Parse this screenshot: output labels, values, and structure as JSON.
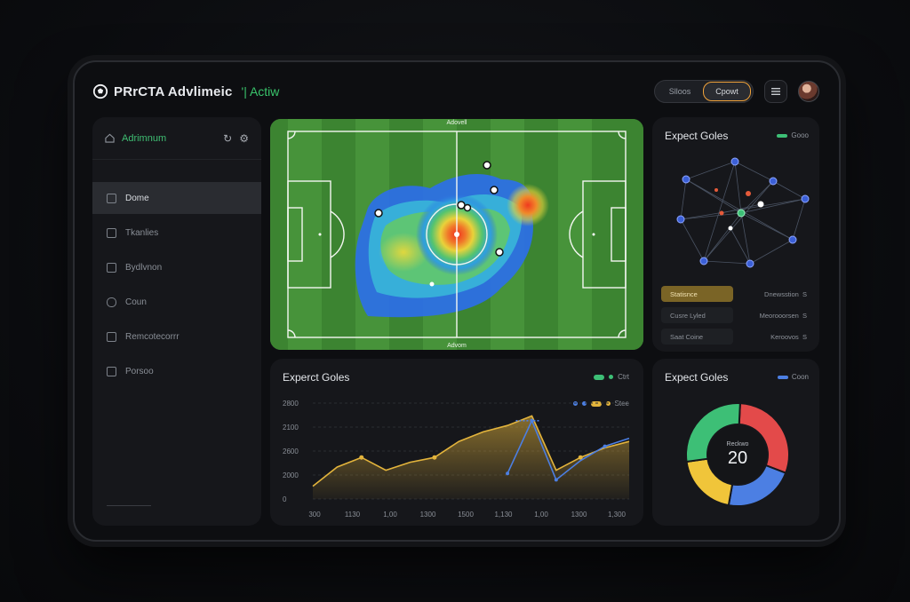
{
  "app": {
    "title": "PRrCTA Advlimeic",
    "accent_text": "'| Actiw",
    "accent_color": "#39c46b"
  },
  "topbar": {
    "toggle": [
      {
        "label": "Slloos",
        "active": false
      },
      {
        "label": "Cpowt",
        "active": true
      }
    ],
    "menu_icon": "sliders-icon",
    "avatar": "user-avatar"
  },
  "sidebar": {
    "header": {
      "label": "Adrimnum",
      "icons": [
        "refresh-icon",
        "settings-icon"
      ]
    },
    "items": [
      {
        "label": "Dome",
        "active": true
      },
      {
        "label": "Tkanlies",
        "active": false
      },
      {
        "label": "Bydlvnon",
        "active": false
      },
      {
        "label": "Coun",
        "active": false
      },
      {
        "label": "Remcotecorrr",
        "active": false
      },
      {
        "label": "Porsoo",
        "active": false
      }
    ]
  },
  "pitch": {
    "top_label": "Adovell",
    "bottom_label": "Advom",
    "heat_hotspots": [
      {
        "label": "primary"
      },
      {
        "label": "secondary"
      }
    ]
  },
  "network": {
    "title": "Expect Goles",
    "legend": "Gooo",
    "list": [
      {
        "label": "Statisnce",
        "hl": true
      },
      {
        "label": "Dnewsstion",
        "plain": true,
        "suffix": "S"
      },
      {
        "label": "Cusre Lyled",
        "hl": false
      },
      {
        "label": "Meorooorsen",
        "plain": true,
        "suffix": "S"
      },
      {
        "label": "Saat Coine",
        "hl": false
      },
      {
        "label": "Keroovos",
        "plain": true,
        "suffix": "S"
      }
    ]
  },
  "line_chart": {
    "title": "Experct Goles",
    "legend_top": "Ctrt",
    "legend_bottom": "Stee",
    "chart_data": {
      "type": "area",
      "title": "Experct Goles",
      "y_ticks": [
        "2800",
        "2100",
        "2600",
        "2000",
        "0"
      ],
      "x_ticks": [
        "300",
        "1130",
        "1,00",
        "1300",
        "1500",
        "1,130",
        "1,00",
        "1300",
        "1,300"
      ],
      "series": [
        {
          "color": "#e3b43c",
          "points": [
            [
              0,
              2080
            ],
            [
              1,
              2200
            ],
            [
              2,
              2260
            ],
            [
              3,
              2180
            ],
            [
              4,
              2230
            ],
            [
              5,
              2260
            ],
            [
              6,
              2360
            ],
            [
              7,
              2420
            ],
            [
              8,
              2460
            ],
            [
              9,
              2520
            ],
            [
              10,
              2180
            ],
            [
              11,
              2260
            ],
            [
              12,
              2320
            ],
            [
              13,
              2360
            ]
          ]
        },
        {
          "color": "#4c7fe3",
          "points": [
            [
              8,
              2160
            ],
            [
              9,
              2490
            ],
            [
              10,
              2120
            ],
            [
              11,
              2240
            ],
            [
              12,
              2330
            ],
            [
              13,
              2380
            ]
          ]
        }
      ]
    }
  },
  "donut": {
    "title": "Expect Goles",
    "legend": "Coon",
    "center_label": "Reckwo",
    "center_value": "20",
    "chart_data": {
      "type": "pie",
      "values": [
        30,
        22,
        20,
        28
      ],
      "colors": [
        "#e34a4a",
        "#4c7fe3",
        "#f0c53a",
        "#3dbf76"
      ]
    }
  }
}
